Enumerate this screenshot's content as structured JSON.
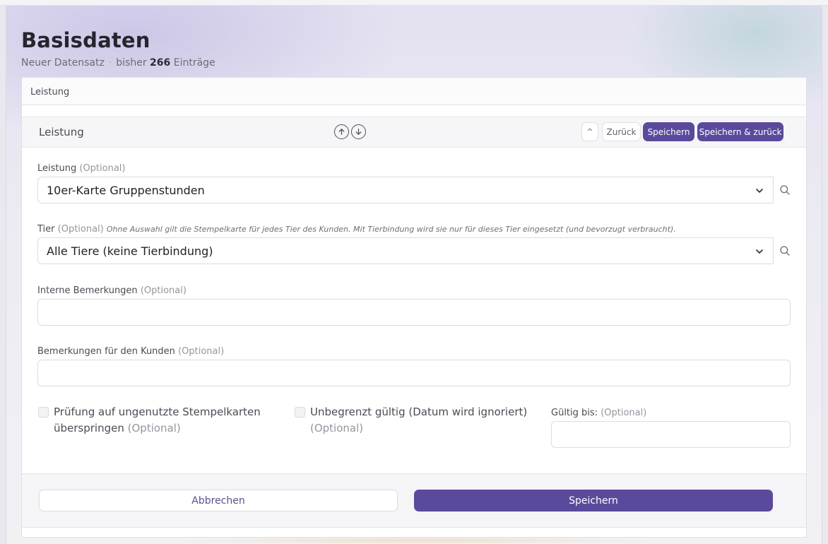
{
  "header": {
    "title": "Basisdaten",
    "subtitle_left": "Neuer Datensatz",
    "subtitle_separator": "·",
    "subtitle_prefix": "bisher",
    "entry_count": "266",
    "subtitle_suffix": "Einträge"
  },
  "breadcrumb": {
    "label": "Leistung"
  },
  "section": {
    "title": "Leistung",
    "collapse_label": "^",
    "back_label": "Zurück",
    "save_label": "Speichern",
    "save_back_label": "Speichern & zurück"
  },
  "form": {
    "leistung": {
      "label": "Leistung",
      "optional": "(Optional)",
      "value": "10er-Karte Gruppenstunden"
    },
    "tier": {
      "label": "Tier",
      "optional": "(Optional)",
      "hint": "Ohne Auswahl gilt die Stempelkarte für jedes Tier des Kunden. Mit Tierbindung wird sie nur für dieses Tier eingesetzt (und bevorzugt verbraucht).",
      "value": "Alle Tiere (keine Tierbindung)"
    },
    "interne_bemerkungen": {
      "label": "Interne Bemerkungen",
      "optional": "(Optional)",
      "value": ""
    },
    "bemerkungen_kunde": {
      "label": "Bemerkungen für den Kunden",
      "optional": "(Optional)",
      "value": ""
    },
    "skip_check": {
      "label_line1": "Prüfung auf ungenutzte Stempelkarten",
      "label_line2": "überspringen",
      "optional": "(Optional)",
      "checked": false
    },
    "unlimited": {
      "label_line1": "Unbegrenzt gültig (Datum wird ignoriert)",
      "optional": "(Optional)",
      "checked": false
    },
    "valid_until": {
      "label": "Gültig bis:",
      "optional": "(Optional)",
      "value": ""
    }
  },
  "footer": {
    "cancel_label": "Abbrechen",
    "save_label": "Speichern"
  },
  "colors": {
    "accent": "#5b4a9c",
    "border": "#dcdce3",
    "text": "#2b2b33",
    "muted": "#95959e"
  },
  "icons": [
    "arrow-up-circle-icon",
    "arrow-down-circle-icon",
    "chevron-down-icon",
    "search-icon"
  ]
}
